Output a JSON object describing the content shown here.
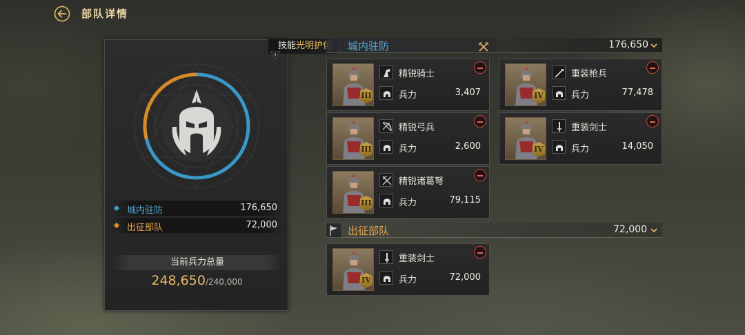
{
  "header": {
    "title": "部队详情"
  },
  "summary": {
    "stats": [
      {
        "label": "城内驻防",
        "value": "176,650",
        "color": "#3a98c8"
      },
      {
        "label": "出征部队",
        "value": "72,000",
        "color": "#d68a2a"
      }
    ],
    "total_label": "当前兵力总量",
    "total_current": "248,650",
    "total_capacity": "/240,000",
    "ring": {
      "garrison_fraction": 0.71,
      "march_fraction": 0.29
    }
  },
  "skill": {
    "prefix": "技能",
    "name": "光明护佑"
  },
  "garrison": {
    "title": "城内驻防",
    "total": "176,650",
    "units": [
      {
        "name": "精锐骑士",
        "force_label": "兵力",
        "force": "3,407",
        "rank": "III",
        "type_icon": "horse-icon"
      },
      {
        "name": "重装枪兵",
        "force_label": "兵力",
        "force": "77,478",
        "rank": "IV",
        "type_icon": "spear-icon"
      },
      {
        "name": "精锐弓兵",
        "force_label": "兵力",
        "force": "2,600",
        "rank": "III",
        "type_icon": "bow-icon"
      },
      {
        "name": "重装剑士",
        "force_label": "兵力",
        "force": "14,050",
        "rank": "IV",
        "type_icon": "sword-icon"
      },
      {
        "name": "精锐诸葛弩",
        "force_label": "兵力",
        "force": "79,115",
        "rank": "III",
        "type_icon": "crossbow-icon"
      }
    ]
  },
  "march": {
    "title": "出征部队",
    "total": "72,000",
    "units": [
      {
        "name": "重装剑士",
        "force_label": "兵力",
        "force": "72,000",
        "rank": "IV",
        "type_icon": "sword-icon"
      }
    ]
  }
}
